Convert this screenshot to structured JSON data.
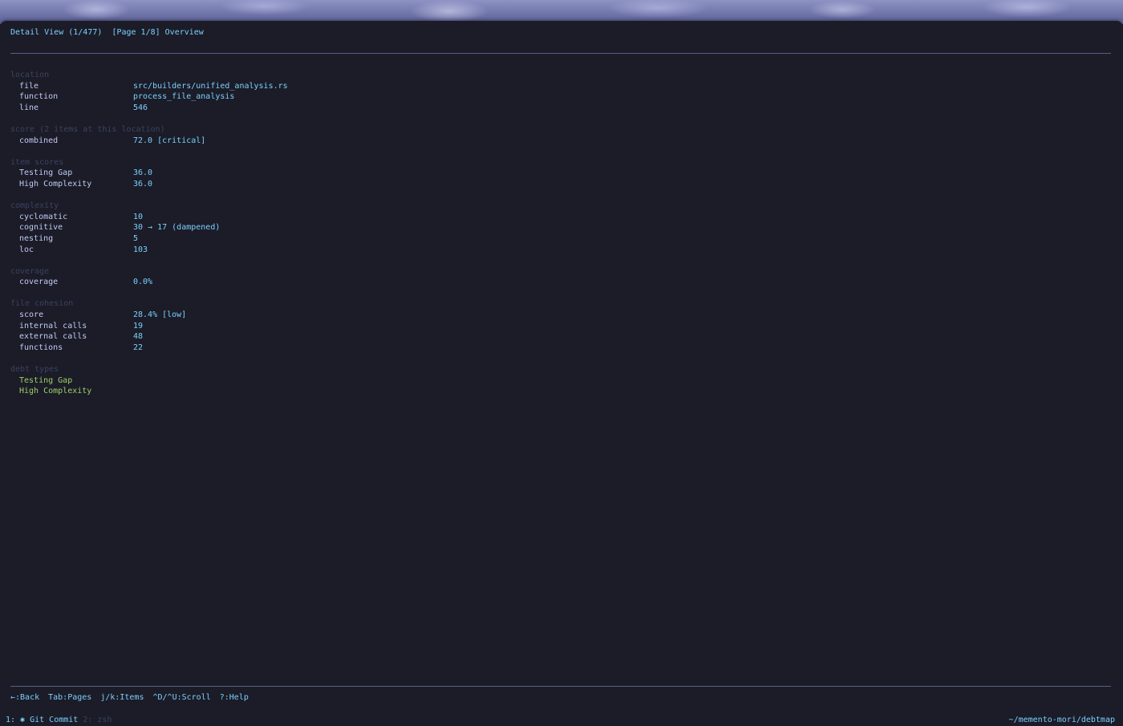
{
  "header": {
    "view": "Detail View (1/477)",
    "page": "[Page 1/8] Overview"
  },
  "sections": {
    "location": {
      "title": "location",
      "rows": [
        {
          "label": "file",
          "value": "src/builders/unified_analysis.rs"
        },
        {
          "label": "function",
          "value": "process_file_analysis"
        },
        {
          "label": "line",
          "value": "546"
        }
      ]
    },
    "score": {
      "title": "score (2 items at this location)",
      "rows": [
        {
          "label": "combined",
          "value": "72.0 [critical]"
        }
      ]
    },
    "item_scores": {
      "title": "item scores",
      "rows": [
        {
          "label": "Testing Gap",
          "value": "36.0"
        },
        {
          "label": "High Complexity",
          "value": "36.0"
        }
      ]
    },
    "complexity": {
      "title": "complexity",
      "rows": [
        {
          "label": "cyclomatic",
          "value": "10"
        },
        {
          "label": "cognitive",
          "value": "30 → 17 (dampened)"
        },
        {
          "label": "nesting",
          "value": "5"
        },
        {
          "label": "loc",
          "value": "103"
        }
      ]
    },
    "coverage": {
      "title": "coverage",
      "rows": [
        {
          "label": "coverage",
          "value": "0.0%"
        }
      ]
    },
    "file_cohesion": {
      "title": "file cohesion",
      "rows": [
        {
          "label": "score",
          "value": "28.4% [low]"
        },
        {
          "label": "internal calls",
          "value": "19"
        },
        {
          "label": "external calls",
          "value": "48"
        },
        {
          "label": "functions",
          "value": "22"
        }
      ]
    },
    "debt_types": {
      "title": "debt types",
      "items": [
        "Testing Gap",
        "High Complexity"
      ]
    }
  },
  "footer": {
    "back": "←:Back",
    "pages": "Tab:Pages",
    "items": "j/k:Items",
    "scroll": "^D/^U:Scroll",
    "help": "?:Help"
  },
  "statusbar": {
    "tab1": "1: ✱ Git Commit",
    "tab2": "2: zsh",
    "cwd": "~/memento-mori/debtmap"
  },
  "colors": {
    "accent": "#7dcfff",
    "label": "#c0caf5",
    "section_title": "#3b4261",
    "debt_type": "#9ece6a",
    "background": "#1b1c27"
  }
}
